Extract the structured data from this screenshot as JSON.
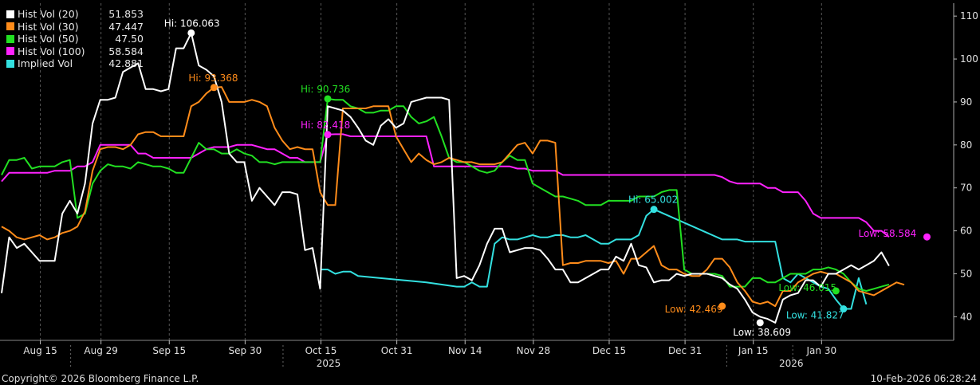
{
  "chart_data": {
    "type": "line",
    "x_tick_labels": [
      "Aug 15",
      "Aug 29",
      "Sep 15",
      "Sep 30",
      "Oct 15",
      "Oct 31",
      "Nov 14",
      "Nov 28",
      "Dec 15",
      "Dec 31",
      "Jan 15",
      "Jan 30"
    ],
    "year_labels": [
      "2025",
      "2026"
    ],
    "y_ticks": [
      40,
      50,
      60,
      70,
      80,
      90,
      100,
      110
    ],
    "ylim": [
      34.5,
      113
    ],
    "y_axis_side": "right",
    "grid": "dashed vertical",
    "legend_position": "top-left",
    "series": [
      {
        "name": "Hist Vol (20)",
        "last_value": "51.853",
        "color": "#ffffff",
        "values": [
          45.5,
          58.5,
          56,
          57,
          55,
          53,
          53,
          53,
          64,
          67,
          64,
          71,
          85,
          90.5,
          90.5,
          91,
          97,
          98,
          99,
          93,
          93,
          92.5,
          93,
          102.5,
          102.5,
          106.063,
          98.5,
          97.5,
          96,
          90,
          78,
          76,
          76,
          67,
          70,
          68,
          66,
          69,
          69,
          68.5,
          55.5,
          56,
          46.5,
          89,
          88.5,
          88,
          86.5,
          84,
          81,
          80,
          84.5,
          86,
          84,
          85,
          90,
          90.5,
          91,
          91,
          91,
          90.5,
          49,
          49.5,
          48.5,
          52,
          57,
          60.5,
          60.5,
          55,
          55.5,
          56,
          56,
          55.5,
          53.5,
          51,
          51,
          48,
          48,
          49,
          50,
          51,
          51,
          54,
          53,
          57,
          52,
          51.5,
          48,
          48.5,
          48.5,
          50,
          49.5,
          50,
          50,
          50,
          49.5,
          49,
          47.5,
          46.5,
          44,
          41,
          40,
          39.5,
          38.609,
          44,
          45,
          45.5,
          48.5,
          48.5,
          47,
          50,
          50,
          51,
          52,
          51,
          52,
          53,
          55,
          51.853
        ],
        "high": {
          "label": "Hi: 106.063",
          "value": 106.063,
          "index": 25
        },
        "low": {
          "label": "Low: 38.609",
          "value": 38.609,
          "index": 100
        }
      },
      {
        "name": "Hist Vol (30)",
        "last_value": "47.447",
        "color": "#ff8c1a",
        "values": [
          61,
          60,
          58.5,
          58,
          58.5,
          59,
          58,
          58.5,
          59.5,
          60,
          61,
          64.5,
          74,
          79,
          79.5,
          79.5,
          79,
          80,
          82.5,
          83,
          83,
          82,
          82,
          82,
          82,
          89,
          90,
          92,
          93.368,
          93.5,
          90,
          90,
          90,
          90.5,
          90,
          89,
          84,
          81,
          79,
          79.5,
          79,
          79,
          69,
          66,
          66,
          88.5,
          88.5,
          88.5,
          88.5,
          89,
          89,
          89,
          82,
          79,
          76,
          78,
          76.5,
          75.5,
          76,
          77,
          76.5,
          76,
          76,
          75.5,
          75.5,
          75.5,
          76,
          78,
          80,
          80.5,
          78,
          81,
          81,
          80.5,
          52,
          52.5,
          52.5,
          53,
          53,
          53,
          52.5,
          53,
          50,
          53.5,
          53.5,
          55,
          56.5,
          52,
          51,
          51,
          50,
          49.5,
          49.5,
          51,
          53.5,
          53.5,
          51.5,
          48,
          46,
          43.5,
          43,
          43.5,
          42.469,
          46,
          46,
          48,
          49,
          50,
          50.5,
          50,
          50,
          49,
          48,
          46,
          45.5,
          45,
          46,
          47,
          48,
          47.447
        ],
        "high": {
          "label": "Hi: 93.368",
          "value": 93.368,
          "index": 28
        },
        "low": {
          "label": "Low: 42.469",
          "value": 42.469,
          "index": 95
        }
      },
      {
        "name": "Hist Vol (50)",
        "last_value": "47.50",
        "color": "#22e022",
        "values": [
          73,
          76.5,
          76.5,
          77,
          74.5,
          75,
          75,
          75,
          76,
          76.5,
          63,
          64,
          71,
          74,
          75.5,
          75,
          75,
          74.5,
          76,
          75.5,
          75,
          75,
          74.5,
          73.5,
          73.5,
          77,
          80.5,
          79,
          79,
          78,
          78,
          79,
          78,
          77.5,
          76,
          76,
          75.5,
          76,
          76,
          76,
          76,
          76,
          76,
          90.736,
          90.5,
          90.5,
          89,
          88.5,
          87.5,
          87.5,
          88,
          88,
          89,
          89,
          86.5,
          85,
          85.5,
          86.5,
          82,
          77,
          76,
          76,
          75,
          74,
          73.5,
          74,
          76,
          77.5,
          76.5,
          76.5,
          71,
          70,
          69,
          68,
          68,
          67.5,
          67,
          66,
          66,
          66,
          67,
          67,
          67,
          67,
          68,
          68,
          68,
          69,
          69.5,
          69.5,
          51,
          50,
          50,
          50,
          50,
          49.5,
          47,
          47,
          47,
          49,
          49,
          48,
          48,
          49,
          50,
          50,
          50,
          51,
          51,
          51.5,
          51,
          50,
          48,
          46.5,
          46.015,
          46.5,
          47,
          47.5
        ],
        "high": {
          "label": "Hi: 90.736",
          "value": 90.736,
          "index": 43
        },
        "low": {
          "label": "Low: 46.015",
          "value": 46.015,
          "index": 110
        }
      },
      {
        "name": "Hist Vol (100)",
        "last_value": "58.584",
        "color": "#ff22ff",
        "values": [
          71.5,
          73.5,
          73.5,
          73.5,
          73.5,
          73.5,
          73.5,
          74,
          74,
          74,
          75,
          75,
          76,
          80,
          80,
          80,
          80,
          80,
          78,
          78,
          77,
          77,
          77,
          77,
          77,
          77,
          78,
          79,
          79.5,
          79.5,
          79.5,
          80,
          80,
          80,
          79.5,
          79,
          79,
          78,
          77,
          77,
          76,
          76,
          76,
          82.418,
          82.5,
          82.5,
          82,
          82,
          82,
          82,
          82,
          82,
          82,
          82,
          82,
          82,
          82,
          75,
          75,
          75,
          75,
          75,
          75,
          75,
          75,
          75,
          75,
          75,
          74.5,
          74.5,
          74,
          74,
          74,
          74,
          73,
          73,
          73,
          73,
          73,
          73,
          73,
          73,
          73,
          73,
          73,
          73,
          73,
          73,
          73,
          73,
          73,
          73,
          73,
          73,
          73,
          72.5,
          71.5,
          71,
          71,
          71,
          71,
          70,
          70,
          69,
          69,
          69,
          67,
          64,
          63,
          63,
          63,
          63,
          63,
          63,
          62,
          60,
          60,
          58.584
        ],
        "high": {
          "label": "Hi: 82.418",
          "value": 82.418,
          "index": 43
        },
        "low": {
          "label": "Low: 58.584",
          "value": 58.584,
          "index": 122
        }
      },
      {
        "name": "Implied Vol",
        "last_value": "42.881",
        "color": "#33e0e0",
        "x_index": [
          42,
          43,
          44,
          45,
          46,
          47,
          56,
          60,
          61,
          62,
          63,
          64,
          65,
          66,
          67,
          68,
          69,
          70,
          71,
          72,
          73,
          74,
          75,
          76,
          77,
          78,
          79,
          80,
          81,
          82,
          83,
          84,
          85,
          86,
          95,
          96,
          97,
          98,
          99,
          100,
          101,
          102,
          103,
          104,
          105,
          106,
          107,
          108,
          109,
          110,
          111,
          112,
          113,
          114
        ],
        "values": [
          51,
          51,
          50,
          50.5,
          50.5,
          49.5,
          48,
          47,
          47,
          48,
          47,
          47,
          57,
          58.5,
          58,
          58,
          58.5,
          59,
          58.5,
          58.5,
          59,
          59,
          58.5,
          58.5,
          59,
          58,
          57,
          57,
          58,
          58,
          58,
          59,
          63.5,
          65.002,
          58,
          58,
          58,
          57.5,
          57.5,
          57.5,
          57.5,
          57.5,
          49,
          48,
          50,
          49,
          48,
          47,
          46.5,
          44,
          41.827,
          41.827,
          49,
          42.881
        ],
        "high": {
          "label": "Hi: 65.002",
          "value": 65.002,
          "index": 86
        },
        "low": {
          "label": "Low: 41.827",
          "value": 41.827,
          "index": 111
        }
      }
    ]
  },
  "footer": {
    "copyright": "Copyright© 2026 Bloomberg Finance L.P.",
    "timestamp": "10-Feb-2026 06:28:24"
  }
}
